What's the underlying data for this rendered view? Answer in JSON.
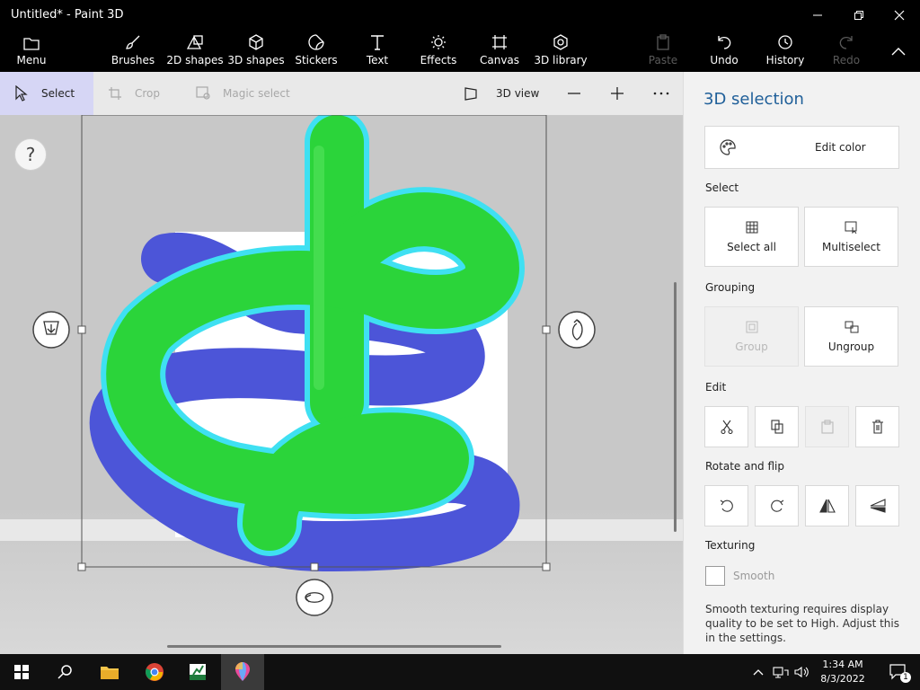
{
  "window": {
    "title": "Untitled* - Paint 3D"
  },
  "ribbon": {
    "menu": "Menu",
    "tools": [
      {
        "label": "Brushes",
        "icon": "brush-icon"
      },
      {
        "label": "2D shapes",
        "icon": "2d-shapes-icon"
      },
      {
        "label": "3D shapes",
        "icon": "3d-shapes-icon"
      },
      {
        "label": "Stickers",
        "icon": "stickers-icon"
      },
      {
        "label": "Text",
        "icon": "text-icon"
      },
      {
        "label": "Effects",
        "icon": "effects-icon"
      },
      {
        "label": "Canvas",
        "icon": "canvas-icon"
      },
      {
        "label": "3D library",
        "icon": "3d-library-icon"
      }
    ],
    "paste": "Paste",
    "undo": "Undo",
    "history": "History",
    "redo": "Redo"
  },
  "toolbar": {
    "select": "Select",
    "crop": "Crop",
    "magic_select": "Magic select",
    "view3d": "3D view"
  },
  "canvas": {
    "help": "?"
  },
  "panel": {
    "title": "3D selection",
    "edit_color": "Edit color",
    "select_heading": "Select",
    "select_all": "Select all",
    "multiselect": "Multiselect",
    "grouping_heading": "Grouping",
    "group": "Group",
    "ungroup": "Ungroup",
    "edit_heading": "Edit",
    "rotate_heading": "Rotate and flip",
    "texturing_heading": "Texturing",
    "smooth": "Smooth",
    "note": "Smooth texturing requires display quality to be set to High. Adjust this in the settings."
  },
  "taskbar": {
    "time": "1:34 AM",
    "date": "8/3/2022",
    "notification_count": "1"
  },
  "colors": {
    "green": "#2bd43a",
    "blue": "#4c55d8",
    "outline": "#3fe0f2",
    "accent": "#1f5f99"
  }
}
